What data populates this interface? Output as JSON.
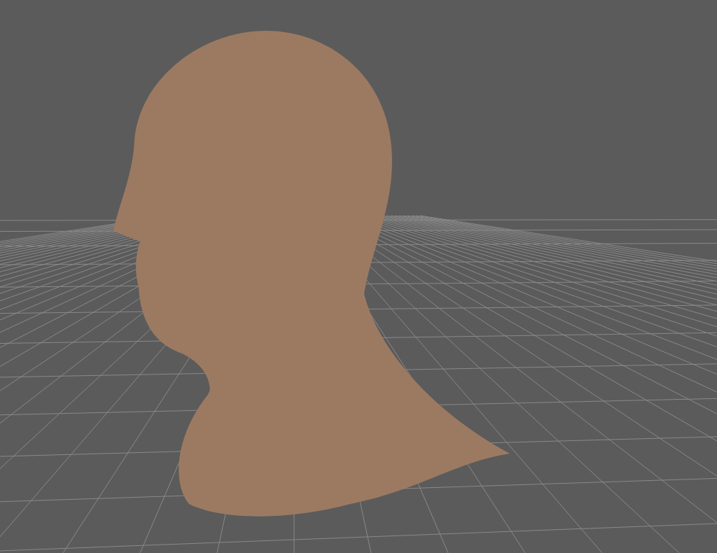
{
  "viewport": {
    "grid_visible": true
  }
}
